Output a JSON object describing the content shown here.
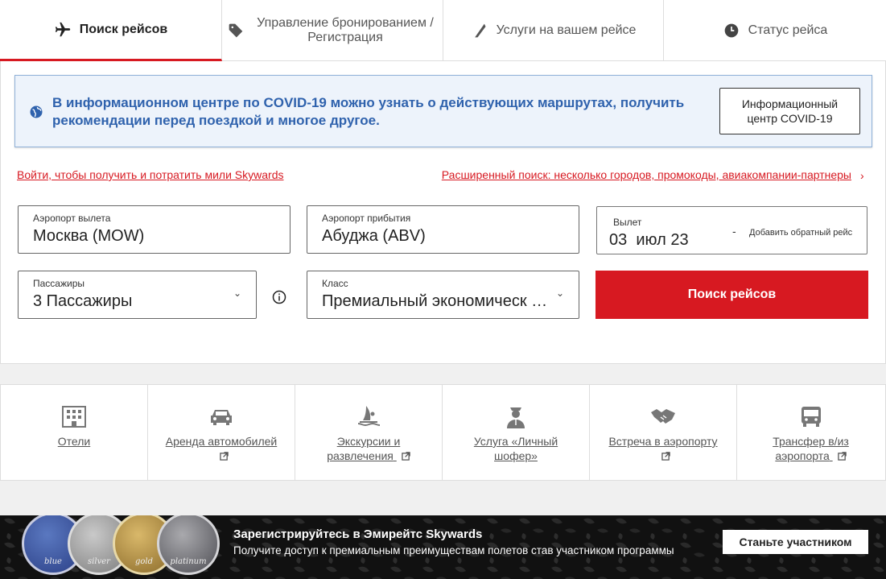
{
  "tabs": [
    {
      "label": "Поиск рейсов",
      "icon": "plane-icon"
    },
    {
      "label": "Управление бронированием / Регистрация",
      "icon": "tag-icon"
    },
    {
      "label": "Услуги на вашем рейсе",
      "icon": "seat-icon"
    },
    {
      "label": "Статус рейса",
      "icon": "clock-icon"
    }
  ],
  "covid": {
    "message": "В информационном центре по COVID-19 можно узнать о действующих маршрутах, получить рекомендации перед поездкой и многое другое.",
    "button": "Информационный центр COVID-19"
  },
  "links": {
    "login": "Войти, чтобы получить и потратить мили Skywards",
    "advanced": "Расширенный поиск: несколько городов, промокоды, авиакомпании-партнеры"
  },
  "form": {
    "from_label": "Аэропорт вылета",
    "from_value": "Москва (MOW)",
    "to_label": "Аэропорт прибытия",
    "to_value": "Абуджа (ABV)",
    "date_label": "Вылет",
    "date_value": "03  июл 23",
    "date_dash": "-",
    "return_label": "Добавить обратный рейс",
    "pax_label": "Пассажиры",
    "pax_value": "3 Пассажиры",
    "class_label": "Класс",
    "class_value": "Премиальный экономическ …",
    "search_button": "Поиск рейсов"
  },
  "services": [
    {
      "label": "Отели",
      "icon": "hotel-icon",
      "external": false
    },
    {
      "label": "Аренда автомобилей",
      "icon": "car-icon",
      "external": true
    },
    {
      "label": "Экскурсии и развлечения",
      "icon": "windsurf-icon",
      "external": true
    },
    {
      "label": "Услуга «Личный шофер»",
      "icon": "chauffeur-icon",
      "external": false
    },
    {
      "label": "Встреча в аэропорту",
      "icon": "handshake-icon",
      "external": true
    },
    {
      "label": "Трансфер в/из аэропорта",
      "icon": "bus-icon",
      "external": true
    }
  ],
  "banner": {
    "title": "Зарегистрируйтесь в Эмирейтс Skywards",
    "subtitle": "Получите доступ к премиальным преимуществам полетов став участником программы",
    "button": "Станьте участником",
    "medals": [
      "blue",
      "silver",
      "gold",
      "platinum"
    ]
  },
  "colors": {
    "accent": "#d71921",
    "covid_text": "#2f62ad",
    "covid_bg": "#edf3fb"
  }
}
